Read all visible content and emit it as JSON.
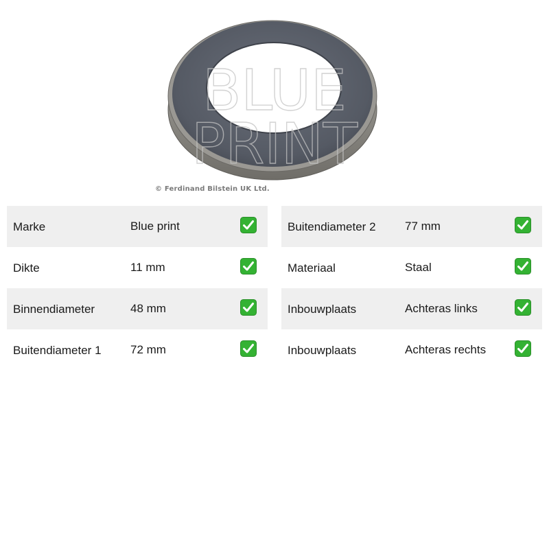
{
  "image": {
    "copyright": "© Ferdinand Bilstein UK Ltd.",
    "watermark_lines": [
      "BLUE",
      "PRINT"
    ]
  },
  "colors": {
    "row_shade": "#efefef",
    "check_green": "#34b233"
  },
  "specs_left": [
    {
      "label": "Marke",
      "value": "Blue print",
      "icon": "check-icon"
    },
    {
      "label": "Dikte",
      "value": "11 mm",
      "icon": "check-icon"
    },
    {
      "label": "Binnendiameter",
      "value": "48 mm",
      "icon": "check-icon"
    },
    {
      "label": "Buitendiameter 1",
      "value": "72 mm",
      "icon": "check-icon"
    }
  ],
  "specs_right": [
    {
      "label": "Buitendiameter 2",
      "value": "77 mm",
      "icon": "check-icon"
    },
    {
      "label": "Materiaal",
      "value": "Staal",
      "icon": "check-icon"
    },
    {
      "label": "Inbouwplaats",
      "value": "Achteras links",
      "icon": "check-icon"
    },
    {
      "label": "Inbouwplaats",
      "value": "Achteras rechts",
      "icon": "check-icon"
    }
  ]
}
